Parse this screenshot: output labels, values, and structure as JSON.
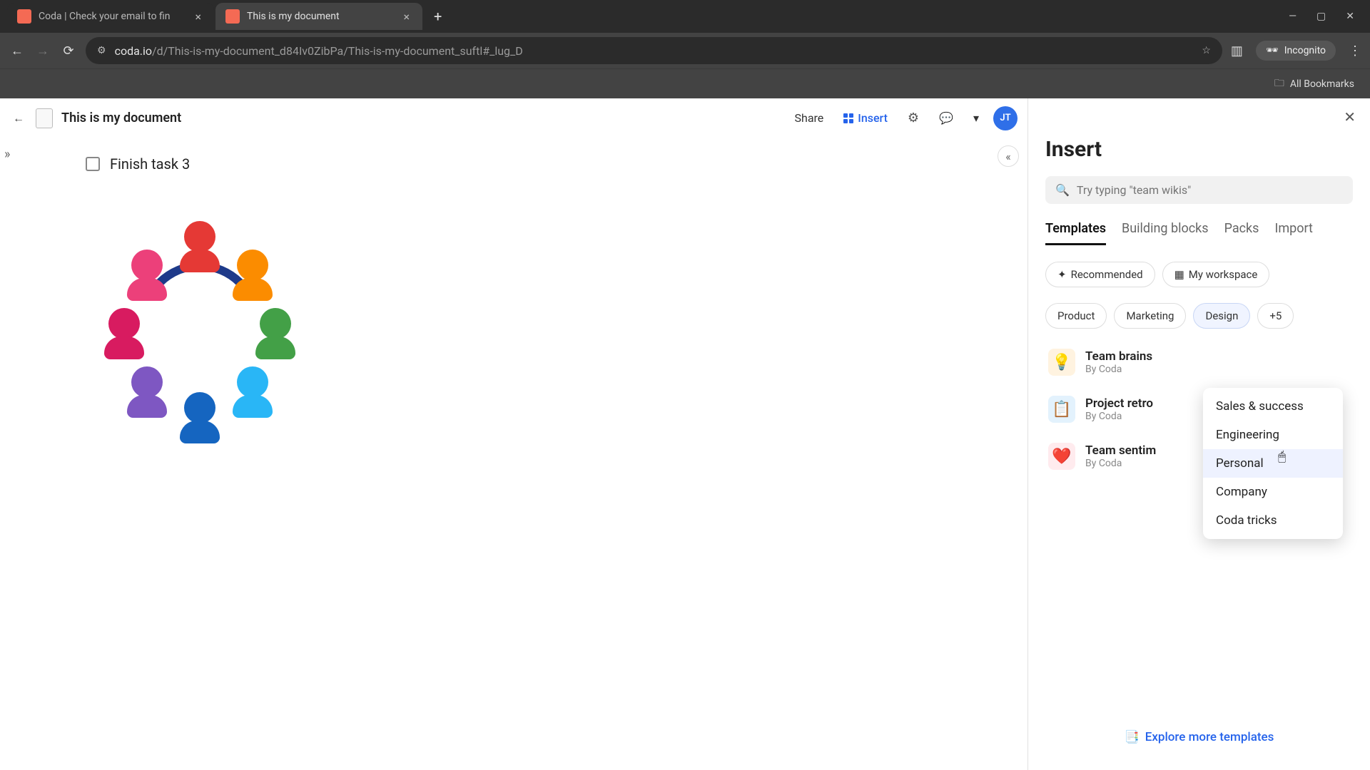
{
  "browser": {
    "tabs": [
      {
        "title": "Coda | Check your email to fin"
      },
      {
        "title": "This is my document"
      }
    ],
    "url_host": "coda.io",
    "url_path": "/d/This-is-my-document_d84Iv0ZibPa/This-is-my-document_suftl#_lug_D",
    "incognito_label": "Incognito",
    "all_bookmarks": "All Bookmarks"
  },
  "header": {
    "doc_title": "This is my document",
    "share": "Share",
    "insert": "Insert",
    "avatar": "JT"
  },
  "doc": {
    "task_label": "Finish task 3"
  },
  "panel": {
    "title": "Insert",
    "search_placeholder": "Try typing \"team wikis\"",
    "tabs": [
      "Templates",
      "Building blocks",
      "Packs",
      "Import"
    ],
    "chips": {
      "recommended": "Recommended",
      "my_workspace": "My workspace",
      "product": "Product",
      "marketing": "Marketing",
      "design": "Design",
      "more": "+5"
    },
    "templates": [
      {
        "title": "Team brains",
        "by": "By Coda",
        "icon": "💡",
        "bg": "#fff3e0"
      },
      {
        "title": "Project retro",
        "by": "By Coda",
        "icon": "📋",
        "bg": "#e3f2fd"
      },
      {
        "title": "Team sentim",
        "by": "By Coda",
        "icon": "❤️",
        "bg": "#ffebee"
      }
    ],
    "explore": "Explore more templates",
    "dropdown": [
      "Sales & success",
      "Engineering",
      "Personal",
      "Company",
      "Coda tricks"
    ]
  }
}
